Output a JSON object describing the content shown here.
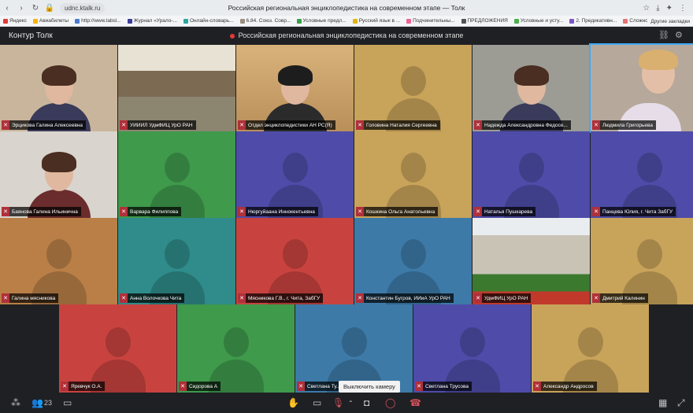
{
  "browser": {
    "url": "udnc.ktalk.ru",
    "title": "Российская региональная энциклопедистика на современном этапе — Толк",
    "bookmarks": [
      "Яндекс",
      "Авиабилеты",
      "http://www.labsl...",
      "Журнал «Урало-...",
      "Онлайн-словарь...",
      "6.84. Союз. Совр...",
      "Условные предл...",
      "Русский язык в ...",
      "Подчинительны...",
      "ПРЕДЛОЖЕНИЯ",
      "Условные и усту...",
      "2. Предикативн...",
      "Сложнопод..."
    ],
    "other_bookmarks": "Другие закладки"
  },
  "app": {
    "name": "Контур Толк",
    "meeting_title": "Российская региональная энциклопедистика на современном этапе",
    "participants_count": "23",
    "tooltip": "Выключить камеру"
  },
  "tiles": [
    {
      "name": "Эрцикова Галина Алексеевна",
      "bg": "#c9b59b",
      "video": true
    },
    {
      "name": "УИИИЛ УдмФИЦ УрО РАН",
      "bg": "#9a8f80",
      "video": true
    },
    {
      "name": "Отдел энциклопедистики АН РС(Я)",
      "bg": "#c7a977",
      "video": true
    },
    {
      "name": "Головина Наталия Сергеевна",
      "bg": "#c8a35a",
      "video": false
    },
    {
      "name": "Надежда Александровна Федосе...",
      "bg": "#9c9c94",
      "video": true
    },
    {
      "name": "Людмила Григорьева",
      "bg": "#b6a89a",
      "video": true
    },
    {
      "name": "Баянова Галина Ильинична",
      "bg": "#d9d4cd",
      "video": true
    },
    {
      "name": "Варвара Филиппова",
      "bg": "#3f9a4c",
      "video": false
    },
    {
      "name": "Нюргуйаана Иннокентьевна",
      "bg": "#4e4ca8",
      "video": false
    },
    {
      "name": "Кошкина Ольга Анатольевна",
      "bg": "#c8a35a",
      "video": false
    },
    {
      "name": "Наталья Пушкарева",
      "bg": "#4e4ca8",
      "video": false
    },
    {
      "name": "Панцева Юлия, г. Чита ЗабГУ",
      "bg": "#4e4ca8",
      "video": false
    },
    {
      "name": "Галина мясникова",
      "bg": "#b97f47",
      "video": false
    },
    {
      "name": "Анна Волочкова Чита",
      "bg": "#2f8c8a",
      "video": false
    },
    {
      "name": "Мясникова Г.В., г. Чита, ЗабГУ",
      "bg": "#c8433f",
      "video": false
    },
    {
      "name": "Константин Бугров, ИИиА УрО РАН",
      "bg": "#3d7aa8",
      "video": false
    },
    {
      "name": "УдмФИЦ УрО РАН",
      "bg": "#8a9a6c",
      "video": true
    },
    {
      "name": "Дмитрий Калинин",
      "bg": "#c8a35a",
      "video": false
    },
    {
      "name": "Яревчук О.А.",
      "bg": "#c8433f",
      "video": false
    },
    {
      "name": "Сидорова А",
      "bg": "#3f9a4c",
      "video": false
    },
    {
      "name": "Светлана Ту...",
      "bg": "#3d7aa8",
      "video": false
    },
    {
      "name": "Светлана Трусова",
      "bg": "#4e4ca8",
      "video": false
    },
    {
      "name": "Александр Андросов",
      "bg": "#c8a35a",
      "video": false
    }
  ]
}
